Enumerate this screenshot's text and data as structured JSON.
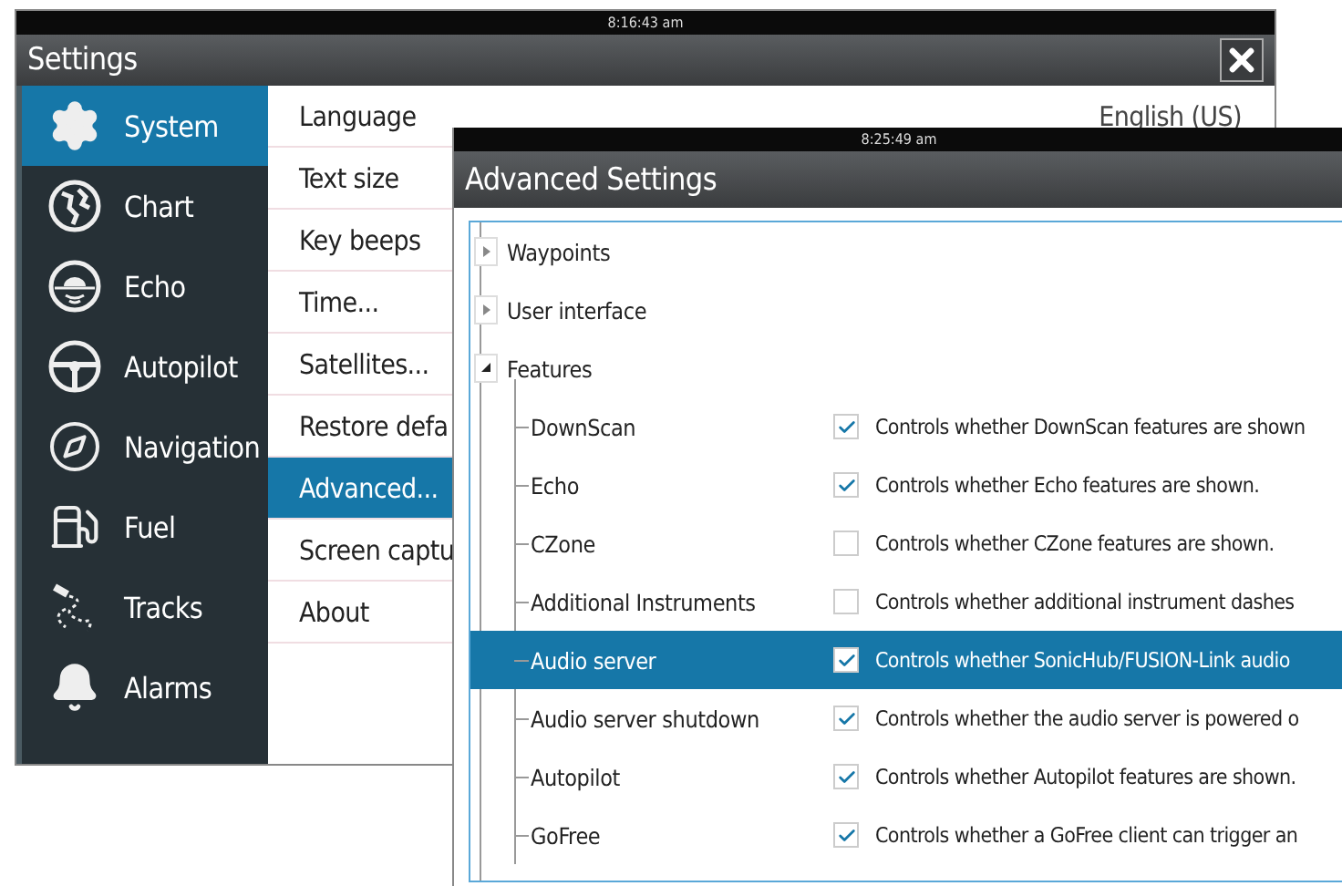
{
  "settings": {
    "status_time": "8:16:43 am",
    "title": "Settings",
    "sidebar": [
      {
        "label": "System",
        "selected": true
      },
      {
        "label": "Chart",
        "selected": false
      },
      {
        "label": "Echo",
        "selected": false
      },
      {
        "label": "Autopilot",
        "selected": false
      },
      {
        "label": "Navigation",
        "selected": false
      },
      {
        "label": "Fuel",
        "selected": false
      },
      {
        "label": "Tracks",
        "selected": false
      },
      {
        "label": "Alarms",
        "selected": false
      }
    ],
    "menu": [
      {
        "label": "Language",
        "value": "English (US)",
        "selected": false
      },
      {
        "label": "Text size",
        "selected": false
      },
      {
        "label": "Key beeps",
        "selected": false
      },
      {
        "label": "Time...",
        "selected": false
      },
      {
        "label": "Satellites...",
        "selected": false
      },
      {
        "label": "Restore defa",
        "selected": false
      },
      {
        "label": "Advanced...",
        "selected": true
      },
      {
        "label": "Screen captu",
        "selected": false
      },
      {
        "label": "About",
        "selected": false
      }
    ]
  },
  "advanced": {
    "status_time": "8:25:49 am",
    "title": "Advanced Settings",
    "tree": [
      {
        "label": "Waypoints",
        "expanded": false
      },
      {
        "label": "User interface",
        "expanded": false
      },
      {
        "label": "Features",
        "expanded": true,
        "children": [
          {
            "label": "DownScan",
            "checked": true,
            "selected": false,
            "description": "Controls whether DownScan features are shown"
          },
          {
            "label": "Echo",
            "checked": true,
            "selected": false,
            "description": "Controls whether Echo features are shown."
          },
          {
            "label": "CZone",
            "checked": false,
            "selected": false,
            "description": "Controls whether CZone features are shown."
          },
          {
            "label": "Additional Instruments",
            "checked": false,
            "selected": false,
            "description": "Controls whether additional instrument dashes"
          },
          {
            "label": "Audio server",
            "checked": true,
            "selected": true,
            "description": "Controls whether SonicHub/FUSION-Link audio"
          },
          {
            "label": "Audio server shutdown",
            "checked": true,
            "selected": false,
            "description": "Controls whether the audio server is powered o"
          },
          {
            "label": "Autopilot",
            "checked": true,
            "selected": false,
            "description": "Controls whether Autopilot features are shown."
          },
          {
            "label": "GoFree",
            "checked": true,
            "selected": false,
            "description": "Controls whether a GoFree client can trigger an"
          }
        ]
      }
    ]
  }
}
